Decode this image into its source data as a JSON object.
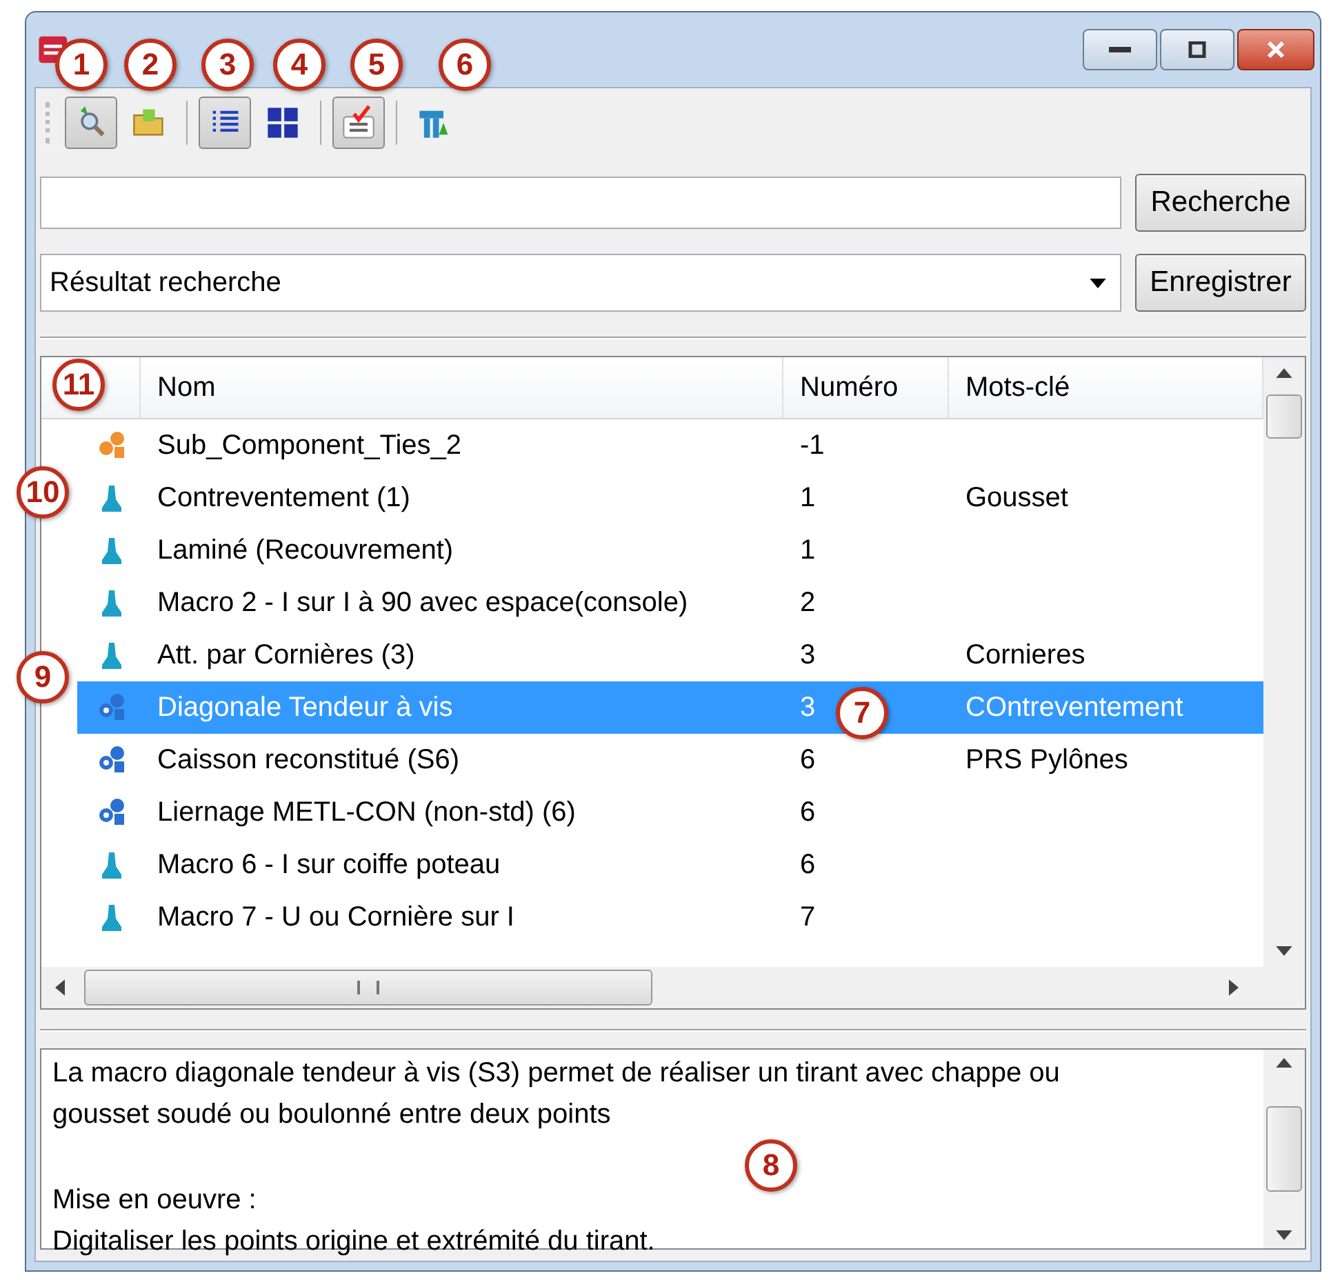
{
  "toolbar": [
    {
      "kind": "find",
      "pressed": true
    },
    {
      "kind": "folder",
      "pressed": false
    },
    {
      "kind": "list",
      "pressed": true
    },
    {
      "kind": "tiles",
      "pressed": false
    },
    {
      "kind": "spell",
      "pressed": true
    },
    {
      "kind": "macro",
      "pressed": false
    }
  ],
  "search": {
    "button": "Recherche"
  },
  "filter": {
    "value": "Résultat recherche",
    "button": "Enregistrer"
  },
  "table": {
    "columns": [
      "Nom",
      "Numéro",
      "Mots-clé"
    ],
    "rows": [
      {
        "kind": "assembly",
        "name": "Sub_Component_Ties_2",
        "number": "-1",
        "keywords": "",
        "selected": false
      },
      {
        "kind": "macro",
        "name": "Contreventement (1)",
        "number": "1",
        "keywords": "Gousset",
        "selected": false
      },
      {
        "kind": "macro",
        "name": "Laminé (Recouvrement)",
        "number": "1",
        "keywords": "",
        "selected": false
      },
      {
        "kind": "macro",
        "name": "Macro 2 - I sur I à 90 avec espace(console)",
        "number": "2",
        "keywords": "",
        "selected": false
      },
      {
        "kind": "macro",
        "name": "Att. par Cornières (3)",
        "number": "3",
        "keywords": "Cornieres",
        "selected": false
      },
      {
        "kind": "component",
        "name": "Diagonale Tendeur à vis",
        "number": "3",
        "keywords": "COntreventement",
        "selected": true
      },
      {
        "kind": "component",
        "name": "Caisson reconstitué (S6)",
        "number": "6",
        "keywords": "PRS Pylônes",
        "selected": false
      },
      {
        "kind": "component",
        "name": "Liernage METL-CON (non-std) (6)",
        "number": "6",
        "keywords": "",
        "selected": false
      },
      {
        "kind": "macro",
        "name": "Macro 6 - I sur coiffe poteau",
        "number": "6",
        "keywords": "",
        "selected": false
      },
      {
        "kind": "macro",
        "name": "Macro 7 - U ou Cornière sur I",
        "number": "7",
        "keywords": "",
        "selected": false
      }
    ]
  },
  "description": [
    "La macro diagonale tendeur à vis (S3) permet de réaliser un tirant avec chappe ou\ngousset soudé ou boulonné entre deux points",
    "Mise en oeuvre :\nDigitaliser les points origine et extrémité du tirant."
  ],
  "callouts": [
    "1",
    "2",
    "3",
    "4",
    "5",
    "6",
    "7",
    "8",
    "9",
    "10",
    "11"
  ]
}
